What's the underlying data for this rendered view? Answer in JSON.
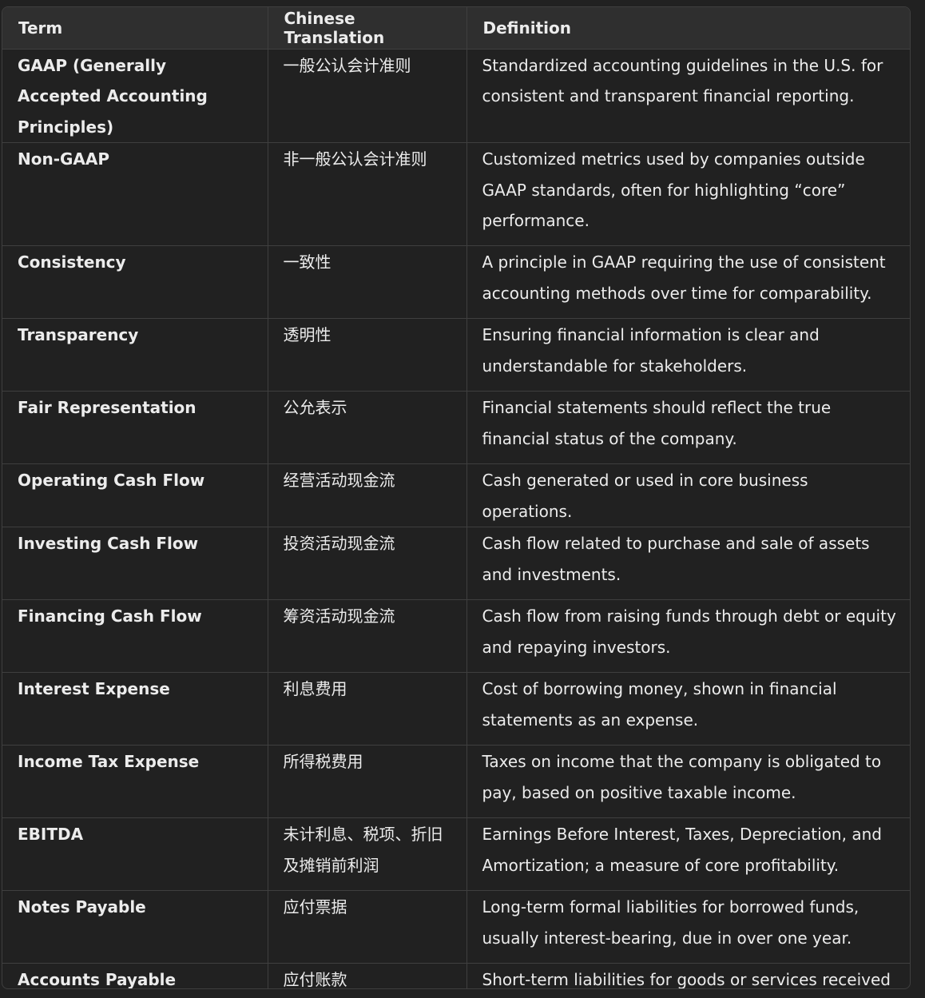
{
  "table": {
    "headers": [
      "Term",
      "Chinese Translation",
      "Definition"
    ],
    "rows": [
      {
        "term": "GAAP (Generally Accepted Accounting Principles)",
        "translation": "一般公认会计准则",
        "definition": "Standardized accounting guidelines in the U.S. for consistent and transparent financial reporting."
      },
      {
        "term": "Non-GAAP",
        "translation": "非一般公认会计准则",
        "definition": "Customized metrics used by companies outside GAAP standards, often for highlighting “core” performance."
      },
      {
        "term": "Consistency",
        "translation": "一致性",
        "definition": "A principle in GAAP requiring the use of consistent accounting methods over time for comparability."
      },
      {
        "term": "Transparency",
        "translation": "透明性",
        "definition": "Ensuring financial information is clear and understandable for stakeholders."
      },
      {
        "term": "Fair Representation",
        "translation": "公允表示",
        "definition": "Financial statements should reflect the true financial status of the company."
      },
      {
        "term": "Operating Cash Flow",
        "translation": "经营活动现金流",
        "definition": "Cash generated or used in core business operations."
      },
      {
        "term": "Investing Cash Flow",
        "translation": "投资活动现金流",
        "definition": "Cash flow related to purchase and sale of assets and investments."
      },
      {
        "term": "Financing Cash Flow",
        "translation": "筹资活动现金流",
        "definition": "Cash flow from raising funds through debt or equity and repaying investors."
      },
      {
        "term": "Interest Expense",
        "translation": "利息费用",
        "definition": "Cost of borrowing money, shown in financial statements as an expense."
      },
      {
        "term": "Income Tax Expense",
        "translation": "所得税费用",
        "definition": "Taxes on income that the company is obligated to pay, based on positive taxable income."
      },
      {
        "term": "EBITDA",
        "translation": "未计利息、税项、折旧及摊销前利润",
        "definition": "Earnings Before Interest, Taxes, Depreciation, and Amortization; a measure of core profitability."
      },
      {
        "term": "Notes Payable",
        "translation": "应付票据",
        "definition": "Long-term formal liabilities for borrowed funds, usually interest-bearing, due in over one year."
      },
      {
        "term": "Accounts Payable",
        "translation": "应付账款",
        "definition": "Short-term liabilities for goods or services received on credit, usually without interest."
      }
    ]
  }
}
